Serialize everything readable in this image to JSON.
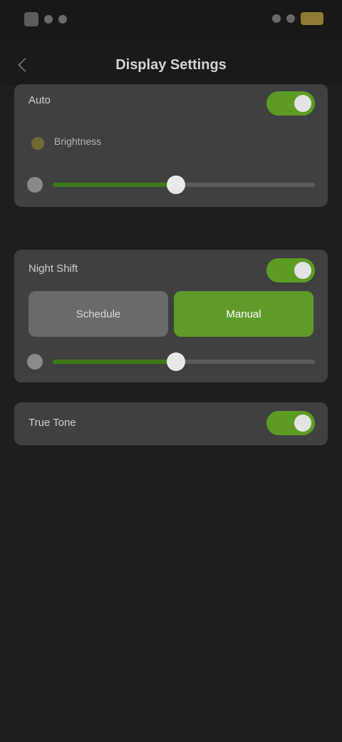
{
  "status_bar": {
    "left_icons": [
      "app-icon",
      "signal-icon",
      "wifi-icon"
    ],
    "right_icons": [
      "signal-icon",
      "wifi-icon",
      "battery-icon"
    ]
  },
  "header": {
    "title": "Display Settings"
  },
  "sections": [
    {
      "title": "Auto",
      "toggle_on": true,
      "subtitle": "Brightness",
      "subtitle_value": "",
      "slider_value_percent": 47
    },
    {
      "title": "Night Shift",
      "toggle_on": true,
      "options": [
        "Schedule",
        "Manual"
      ],
      "selected_option": "Manual",
      "slider_value_percent": 47
    },
    {
      "title": "True Tone",
      "toggle_on": true
    }
  ],
  "colors": {
    "background": "#1f1e1f",
    "card": "#404040",
    "accent": "#5f9b2b"
  }
}
